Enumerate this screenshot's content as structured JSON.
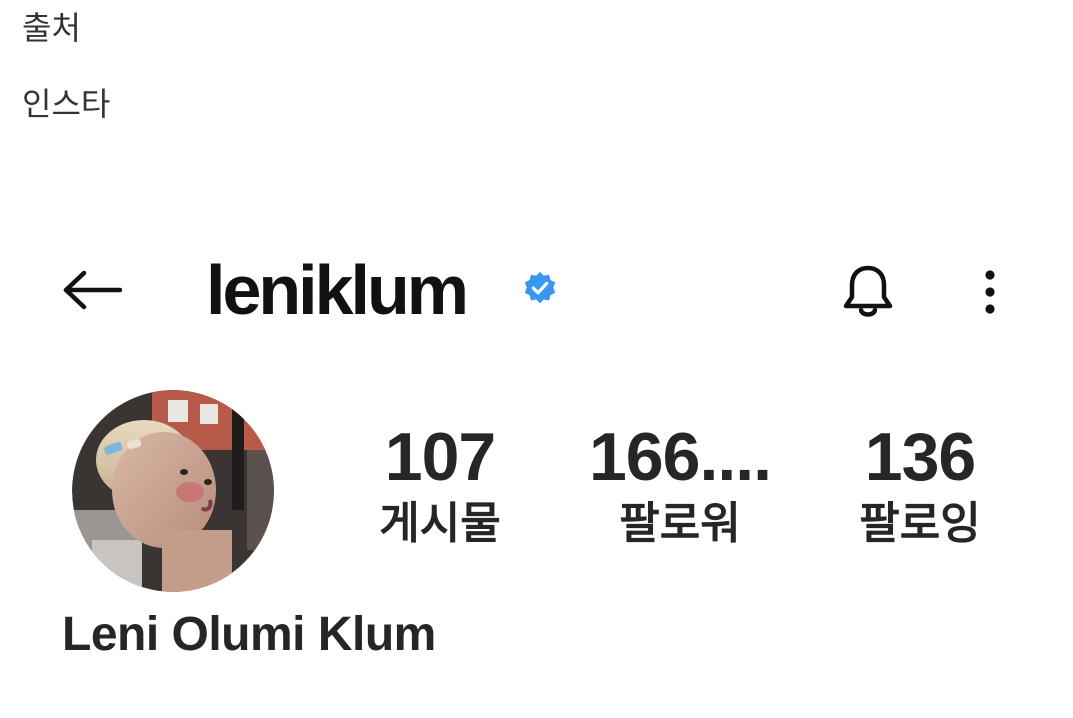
{
  "caption": {
    "source_label": "출처",
    "platform_label": "인스타"
  },
  "header": {
    "username": "leniklum",
    "verified": true,
    "verified_color": "#3897f0"
  },
  "profile": {
    "full_name": "Leni Olumi Klum",
    "stats": [
      {
        "value": "107",
        "label": "게시물"
      },
      {
        "value": "166....",
        "label": "팔로워"
      },
      {
        "value": "136",
        "label": "팔로잉"
      }
    ]
  },
  "icons": {
    "back": "arrow-left-icon",
    "bell": "bell-icon",
    "more": "more-vertical-icon",
    "verified": "verified-badge-icon"
  }
}
